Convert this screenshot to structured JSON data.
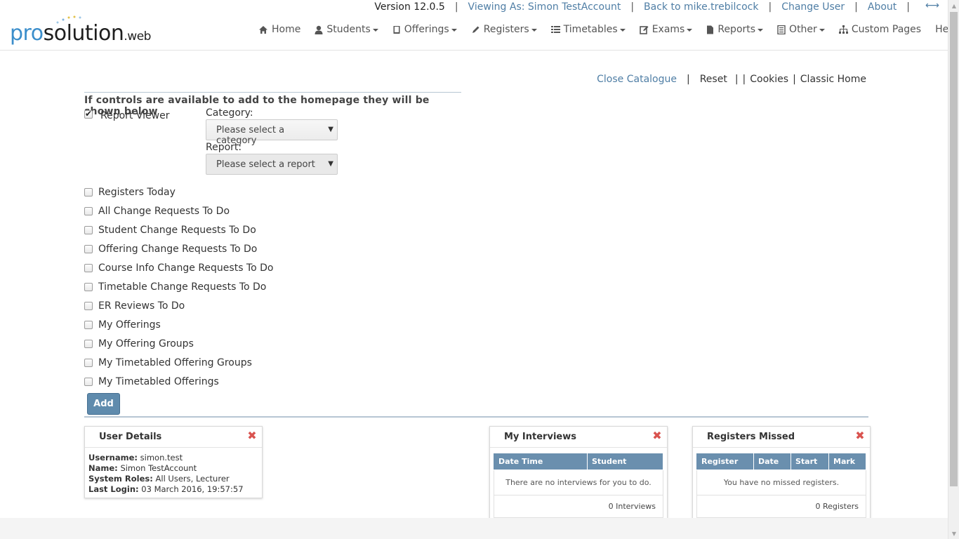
{
  "header": {
    "logo": {
      "part1": "pro",
      "part2": "solution",
      "part3": ".web"
    },
    "version": "Version 12.0.5",
    "viewing_as": "Viewing As: Simon TestAccount",
    "back_to": "Back to mike.trebilcock",
    "change_user": "Change User",
    "about": "About",
    "link_color": "#4f7ea5"
  },
  "nav": {
    "home": "Home",
    "students": "Students",
    "offerings": "Offerings",
    "registers": "Registers",
    "timetables": "Timetables",
    "exams": "Exams",
    "reports": "Reports",
    "other": "Other",
    "custom_pages": "Custom Pages",
    "help": "Help"
  },
  "subbar": {
    "close_catalogue": "Close Catalogue",
    "reset": "Reset",
    "cookies": "Cookies",
    "classic_home": "Classic Home"
  },
  "catalogue": {
    "heading": "If controls are available to add to the homepage they will be shown below",
    "report_viewer": {
      "label": "Report Viewer",
      "checked": true,
      "category_label": "Category:",
      "category_value": "Please select a category",
      "report_label": "Report:",
      "report_value": "Please select a report"
    },
    "items": [
      {
        "label": "Registers Today",
        "checked": false
      },
      {
        "label": "All Change Requests To Do",
        "checked": false
      },
      {
        "label": "Student Change Requests To Do",
        "checked": false
      },
      {
        "label": "Offering Change Requests To Do",
        "checked": false
      },
      {
        "label": "Course Info Change Requests To Do",
        "checked": false
      },
      {
        "label": "Timetable Change Requests To Do",
        "checked": false
      },
      {
        "label": "ER Reviews To Do",
        "checked": false
      },
      {
        "label": "My Offerings",
        "checked": false
      },
      {
        "label": "My Offering Groups",
        "checked": false
      },
      {
        "label": "My Timetabled Offering Groups",
        "checked": false
      },
      {
        "label": "My Timetabled Offerings",
        "checked": false
      }
    ],
    "add_button": "Add",
    "accent": "#5f8bad"
  },
  "widgets": {
    "user_details": {
      "title": "User Details",
      "username_label": "Username:",
      "username": "simon.test",
      "name_label": "Name:",
      "name": "Simon TestAccount",
      "roles_label": "System Roles:",
      "roles": "All Users, Lecturer",
      "last_login_label": "Last Login:",
      "last_login": "03 March 2016, 19:57:57"
    },
    "interviews": {
      "title": "My Interviews",
      "columns": [
        "Date Time",
        "Student"
      ],
      "empty_message": "There are no interviews for you to do.",
      "footer": "0 Interviews"
    },
    "registers_missed": {
      "title": "Registers Missed",
      "columns": [
        "Register",
        "Date",
        "Start",
        "Mark"
      ],
      "empty_message": "You have no missed registers.",
      "footer": "0 Registers"
    },
    "close_color": "#d9534f",
    "header_color": "#6a8fae"
  }
}
